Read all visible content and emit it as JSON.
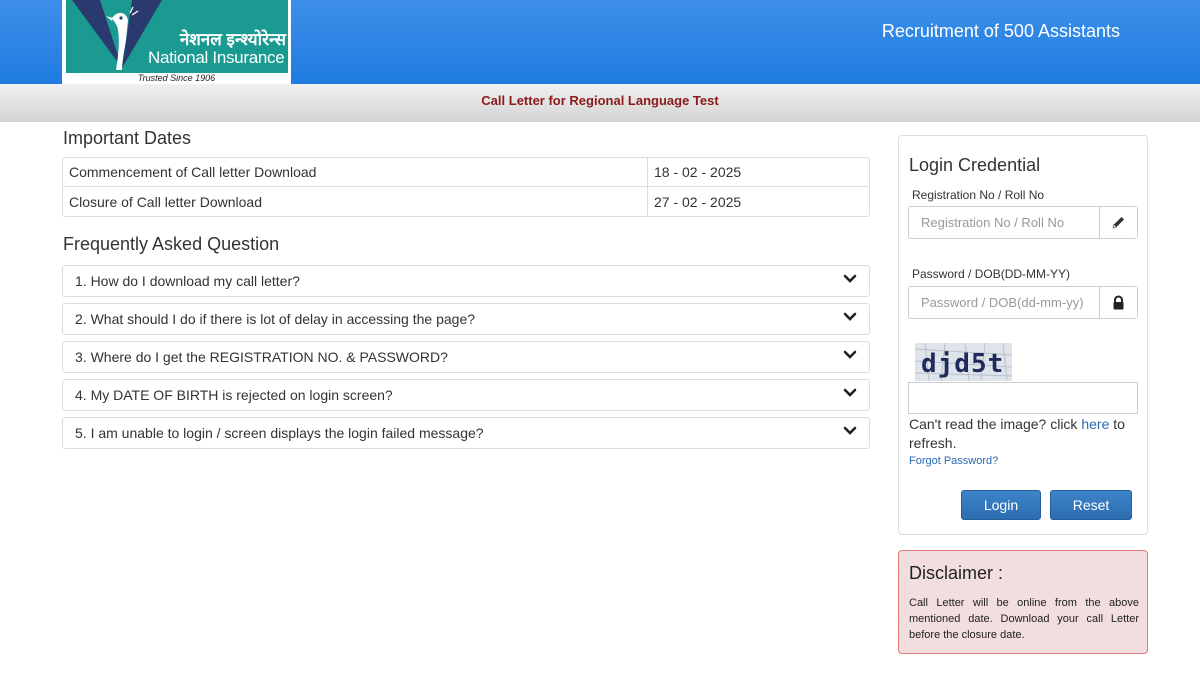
{
  "header": {
    "logo_hindi": "नेशनल इन्श्योरेन्स",
    "logo_english": "National Insurance",
    "logo_tagline": "Trusted Since 1906",
    "title": "Recruitment of 500 Assistants",
    "subtitle": "Call Letter for Regional Language Test",
    "colors": {
      "header_blue": "#2a86e6",
      "subtitle_red": "#8b1a1a",
      "logo_teal": "#1a9a90"
    }
  },
  "important_dates": {
    "title": "Important Dates",
    "rows": [
      {
        "label": "Commencement of Call letter Download",
        "value": "18 - 02 - 2025"
      },
      {
        "label": "Closure of Call letter Download",
        "value": "27 - 02 - 2025"
      }
    ]
  },
  "faq": {
    "title": "Frequently Asked Question",
    "items": [
      "1. How do I download my call letter?",
      "2. What should I do if there is lot of delay in accessing the page?",
      "3. Where do I get the REGISTRATION NO. & PASSWORD?",
      "4. My DATE OF BIRTH is rejected on login screen?",
      "5. I am unable to login / screen displays the login failed message?"
    ],
    "icon": "chevron-down-icon"
  },
  "login": {
    "title": "Login Credential",
    "reg_label": "Registration No / Roll No",
    "reg_placeholder": "Registration No / Roll No",
    "reg_icon": "pencil-icon",
    "pwd_label": "Password / DOB(DD-MM-YY)",
    "pwd_placeholder": "Password / DOB(dd-mm-yy)",
    "pwd_icon": "lock-icon",
    "captcha_text": "djd5t",
    "refresh_prefix": "Can't read the image? click",
    "refresh_link": "here",
    "refresh_suffix": "to refresh.",
    "forgot_password": "Forgot Password?",
    "login_button": "Login",
    "reset_button": "Reset"
  },
  "disclaimer": {
    "title": "Disclaimer :",
    "text": "Call Letter will be online from the above mentioned date. Download your call Letter before the closure date."
  }
}
